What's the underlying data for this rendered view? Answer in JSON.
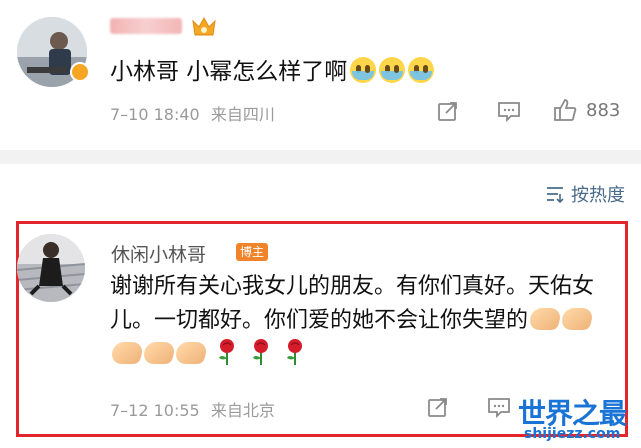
{
  "comment_top": {
    "text": "小林哥 小幂怎么样了啊",
    "emojis": [
      "crying-face",
      "crying-face",
      "crying-face"
    ],
    "time": "7–10 18:40",
    "source": "来自四川",
    "like_count": "883"
  },
  "sort": {
    "label": "按热度"
  },
  "comment_main": {
    "author": "休闲小林哥",
    "badge": "博主",
    "text": "谢谢所有关心我女儿的朋友。有你们真好。天佑女儿。一切都好。你们爱的她不会让你失望的",
    "emojis": [
      "clap",
      "clap",
      "clap",
      "clap",
      "clap",
      "rose",
      "rose",
      "rose"
    ],
    "time": "7–12 10:55",
    "source": "来自北京"
  },
  "watermark": {
    "title": "世界之最",
    "url": "shijiezz.com"
  },
  "colors": {
    "accent_red": "#e3262b",
    "badge_orange": "#f1832a",
    "sort_blue": "#4a6b8a",
    "watermark_blue": "#1a74d6"
  }
}
